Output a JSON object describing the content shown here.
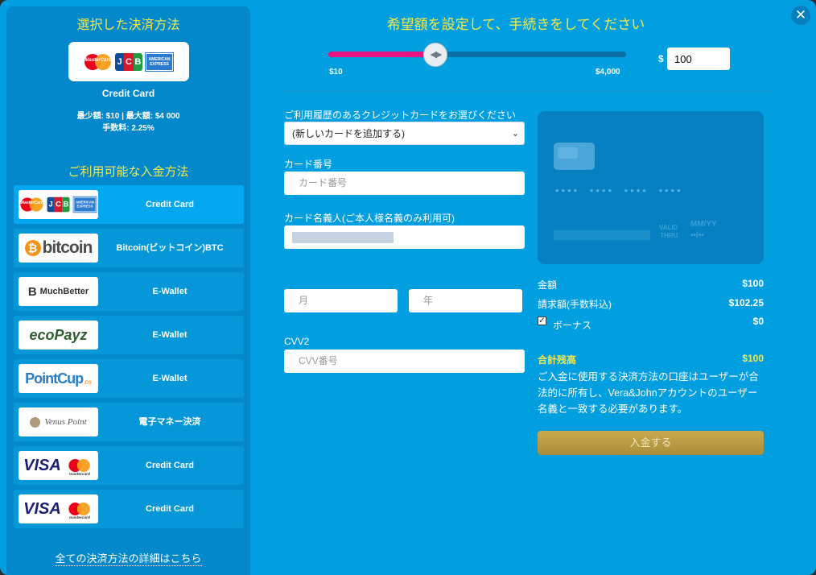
{
  "left": {
    "selected_title": "選択した決済方法",
    "selected_name": "Credit Card",
    "selected_limits": "最少額: $10 | 最大額: $4 000",
    "selected_fee": "手数料: 2.25%",
    "available_title": "ご利用可能な入金方法",
    "all_methods_link": "全ての決済方法の詳細はこちら",
    "logo_text": {
      "mastercard": "MasterCard",
      "jcb": [
        "J",
        "C",
        "B"
      ],
      "amex": "AMERICAN EXPRESS",
      "bitcoin": "bitcoin",
      "bitcoin_symbol": "₿",
      "muchbetter": "MuchBetter",
      "muchbetter_mark": "B",
      "ecopayz": "ecoPayz",
      "pointcup": "PointCup",
      "pointcup_suffix": ".co",
      "venus": "Venus Point",
      "visa": "VISA",
      "visa_mc": "mastercard"
    },
    "methods": [
      {
        "name": "Credit Card",
        "logo": "cards-logo",
        "active": true
      },
      {
        "name": "Bitcoin(ビットコイン)BTC",
        "logo": "bitcoin-logo",
        "active": false
      },
      {
        "name": "E-Wallet",
        "logo": "muchbetter-logo",
        "active": false
      },
      {
        "name": "E-Wallet",
        "logo": "ecopayz-logo",
        "active": false
      },
      {
        "name": "E-Wallet",
        "logo": "pointcup-logo",
        "active": false
      },
      {
        "name": "電子マネー決済",
        "logo": "venuspoint-logo",
        "active": false
      },
      {
        "name": "Credit Card",
        "logo": "visa-mastercard-logo",
        "active": false
      },
      {
        "name": "Credit Card",
        "logo": "visa-mastercard-logo",
        "active": false
      }
    ]
  },
  "header": {
    "title": "希望額を設定して、手続きをしてください",
    "close_icon": "close-icon"
  },
  "slider": {
    "min_label": "$10",
    "max_label": "$4,000",
    "value": 100,
    "min": 10,
    "max": 4000,
    "thumb_glyph": "◀▶"
  },
  "amount": {
    "currency": "$",
    "value": "100"
  },
  "form": {
    "saved_card_label": "ご利用履歴のあるクレジットカードをお選びください",
    "saved_card_value": "(新しいカードを追加する)",
    "card_number_label": "カード番号",
    "card_number_placeholder": "カード番号",
    "card_holder_label": "カード名義人(ご本人様名義のみ利用可)",
    "month_placeholder": "月",
    "year_placeholder": "年",
    "cvv_label": "CVV2",
    "cvv_placeholder": "CVV番号"
  },
  "card_preview": {
    "number": "•••• •••• •••• ••••",
    "valid_label_1": "VALID",
    "valid_label_2": "THRU",
    "mm_yy": "MM/YY",
    "mm_yy_value": "••/••"
  },
  "summary": {
    "amount_label": "金額",
    "amount_value": "$100",
    "charge_label": "請求額(手数料込)",
    "charge_value": "$102.25",
    "bonus_label": "ボーナス",
    "bonus_checked": true,
    "bonus_check_glyph": "✓",
    "bonus_value": "$0",
    "total_label": "合計残高",
    "total_value": "$100",
    "notice": "ご入金に使用する決済方法の口座はユーザーが合法的に所有し、Vera&Johnアカウントのユーザー名義と一致する必要があります。",
    "deposit_button": "入金する"
  },
  "colors": {
    "background": "#019ee0",
    "accent_yellow": "#f6e94a",
    "slider_fill": "#e6147e",
    "button_gold": "#b99a42"
  }
}
